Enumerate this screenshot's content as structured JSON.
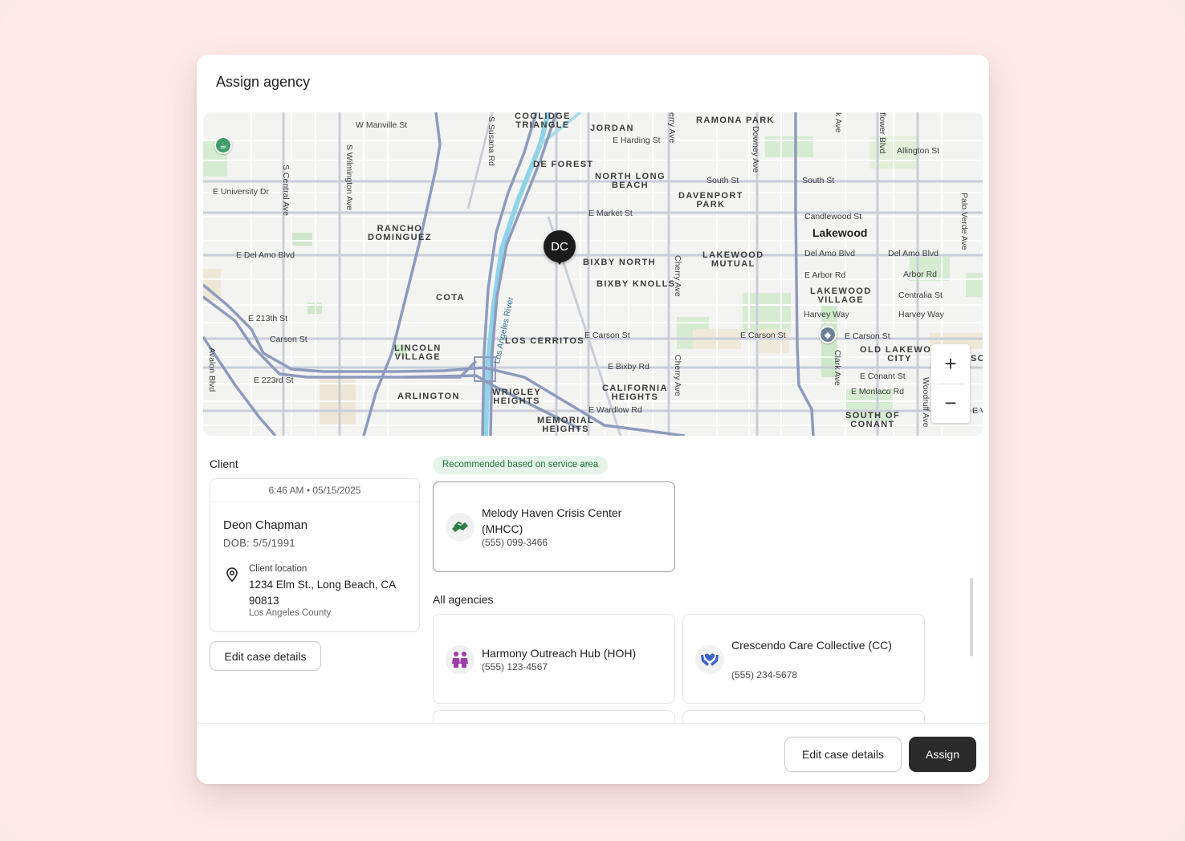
{
  "modal": {
    "title": "Assign agency"
  },
  "map": {
    "pin_label": "DC",
    "zoom_in": "+",
    "zoom_out": "−",
    "labels": {
      "w_manville": "W Manville St",
      "coolidge": "COOLIDGE\nTRIANGLE",
      "jordan": "JORDAN",
      "harding": "E Harding St",
      "ramona": "RAMONA PARK",
      "allington": "Allington St",
      "de_forest": "DE FOREST",
      "north_long_beach": "NORTH LONG\nBEACH",
      "south_st_1": "South St",
      "south_st_2": "South St",
      "davenport": "DAVENPORT\nPARK",
      "e_university": "E University Dr",
      "e_market": "E Market St",
      "candlewood": "Candlewood St",
      "lakewood": "Lakewood",
      "rancho": "RANCHO\nDOMINGUEZ",
      "e_del_amo": "E Del Amo Blvd",
      "bixby_north": "BIXBY NORTH",
      "lakewood_mutual": "LAKEWOOD\nMUTUAL",
      "del_amo_1": "Del Amo Blvd",
      "del_amo_2": "Del Amo Blvd",
      "e_arbor": "E Arbor Rd",
      "arbor": "Arbor Rd",
      "bixby_knolls": "BIXBY KNOLLS",
      "lakewood_village": "LAKEWOOD\nVILLAGE",
      "centralia": "Centralia St",
      "cota": "COTA",
      "harvey_1": "Harvey Way",
      "harvey_2": "Harvey Way",
      "e_213th": "E 213th St",
      "carson": "Carson St",
      "e_carson_1": "E Carson St",
      "e_carson_2": "E Carson St",
      "e_carson_3": "E Carson St",
      "lincoln_village": "LINCOLN\nVILLAGE",
      "los_cerritos": "LOS CERRITOS",
      "old_lakewood": "OLD LAKEWOO\nCITY",
      "e_bixby": "E Bixby Rd",
      "e_conant": "E Conant St",
      "e_223rd": "E 223rd St",
      "california_heights": "CALIFORNIA\nHEIGHTS",
      "e_monlaco": "E Monlaco Rd",
      "arlington": "ARLINGTON",
      "wrigley": "WRIGLEY\nHEIGHTS",
      "e_wardlow": "E Wardlow Rd",
      "south_of_conant": "SOUTH OF\nCONANT",
      "memorial": "MEMORIAL\nHEIGHTS",
      "so": "SO",
      "ev": "E V",
      "s_susana": "S Susana Rd",
      "s_wilmington": "S Wilmington Ave",
      "s_central": "S Central Ave",
      "cherry_1": "erry Ave",
      "cherry_2": "Cherry Ave",
      "cherry_3": "Cherry Ave",
      "downey": "Downey Ave",
      "k_ave": "k Ave",
      "flower": "flower Blvd",
      "palo_verde": "Palo Verde Ave",
      "clark": "Clark Ave",
      "woodruff": "Woodruff Ave",
      "avalon": "Avalon Blvd",
      "wilmington_diag": "S Wilmington Ave",
      "la_river": "Los Angeles River"
    }
  },
  "client": {
    "section_label": "Client",
    "timestamp": "6:46 AM • 05/15/2025",
    "name": "Deon Chapman",
    "dob": "DOB: 5/5/1991",
    "location_caption": "Client location",
    "address": "1234 Elm St., Long Beach, CA 90813",
    "county": "Los Angeles County",
    "edit_button": "Edit case details"
  },
  "agencies": {
    "recommended_badge": "Recommended based on service area",
    "recommended": {
      "name": "Melody Haven Crisis Center (MHCC)",
      "phone": "(555) 099-3466",
      "icon": "helping-hands-icon"
    },
    "all_label": "All agencies",
    "list": [
      {
        "name": "Harmony Outreach Hub (HOH)",
        "phone": "(555) 123-4567",
        "icon": "people-icon"
      },
      {
        "name": "Crescendo Care Collective (CC)",
        "phone": "(555) 234-5678",
        "icon": "hands-heart-icon"
      }
    ]
  },
  "footer": {
    "edit_button": "Edit case details",
    "assign_button": "Assign"
  },
  "colors": {
    "backdrop": "#fdeae8",
    "badge_bg": "#e6f4ea",
    "badge_text": "#1e7a3a",
    "primary_button": "#2b2b2b",
    "map_highway": "#8d9bbd",
    "map_river": "#8fd3e8"
  }
}
